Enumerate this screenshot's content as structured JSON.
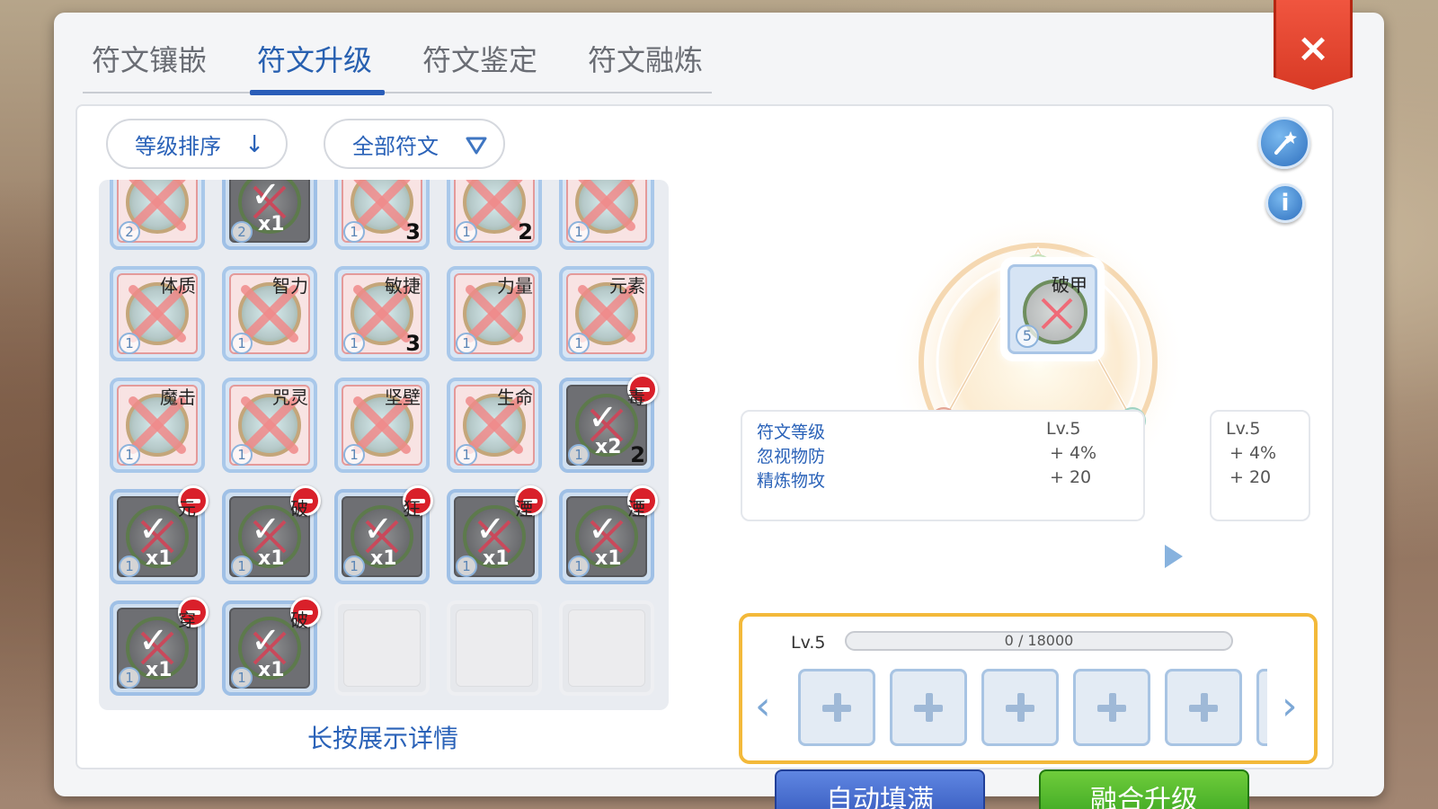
{
  "tabs": [
    {
      "label": "符文镶嵌",
      "active": false
    },
    {
      "label": "符文升级",
      "active": true
    },
    {
      "label": "符文鉴定",
      "active": false
    },
    {
      "label": "符文融炼",
      "active": false
    }
  ],
  "close_label": "×",
  "sort": {
    "label": "等级排序",
    "icon": "arrow-down-icon"
  },
  "filter": {
    "label": "全部符文",
    "icon": "triangle-down-icon"
  },
  "grid": {
    "hint": "长按展示详情",
    "row0": [
      {
        "name": "",
        "level": "2",
        "count": "",
        "mult": "",
        "state": "pink"
      },
      {
        "name": "",
        "level": "2",
        "count": "",
        "mult": "x1",
        "state": "dark"
      },
      {
        "name": "",
        "level": "1",
        "count": "3",
        "mult": "",
        "state": "pink"
      },
      {
        "name": "",
        "level": "1",
        "count": "2",
        "mult": "",
        "state": "pink"
      },
      {
        "name": "",
        "level": "1",
        "count": "",
        "mult": "",
        "state": "pink"
      }
    ],
    "row1": [
      {
        "name": "体质",
        "level": "1",
        "count": "",
        "mult": "",
        "state": "pink"
      },
      {
        "name": "智力",
        "level": "1",
        "count": "",
        "mult": "",
        "state": "pink"
      },
      {
        "name": "敏捷",
        "level": "1",
        "count": "3",
        "mult": "",
        "state": "pink"
      },
      {
        "name": "力量",
        "level": "1",
        "count": "",
        "mult": "",
        "state": "pink"
      },
      {
        "name": "元素",
        "level": "1",
        "count": "",
        "mult": "",
        "state": "pink"
      }
    ],
    "row2": [
      {
        "name": "魔击",
        "level": "1",
        "count": "",
        "mult": "",
        "state": "pink"
      },
      {
        "name": "咒灵",
        "level": "1",
        "count": "",
        "mult": "",
        "state": "pink"
      },
      {
        "name": "坚壁",
        "level": "1",
        "count": "",
        "mult": "",
        "state": "pink"
      },
      {
        "name": "生命",
        "level": "1",
        "count": "",
        "mult": "",
        "state": "pink"
      },
      {
        "name": "毒",
        "level": "1",
        "count": "2",
        "mult": "x2",
        "state": "dark"
      }
    ],
    "row3": [
      {
        "name": "元",
        "level": "1",
        "count": "",
        "mult": "x1",
        "state": "dark"
      },
      {
        "name": "破",
        "level": "1",
        "count": "",
        "mult": "x1",
        "state": "dark"
      },
      {
        "name": "狂",
        "level": "1",
        "count": "",
        "mult": "x1",
        "state": "dark"
      },
      {
        "name": "湮",
        "level": "1",
        "count": "",
        "mult": "x1",
        "state": "dark"
      },
      {
        "name": "湮",
        "level": "1",
        "count": "",
        "mult": "x1",
        "state": "dark"
      }
    ],
    "row4": [
      {
        "name": "穿",
        "level": "1",
        "count": "",
        "mult": "x1",
        "state": "dark"
      },
      {
        "name": "破",
        "level": "1",
        "count": "",
        "mult": "x1",
        "state": "dark"
      }
    ]
  },
  "selected": {
    "name": "破甲",
    "level": "5"
  },
  "stats": {
    "current": {
      "rows": [
        {
          "label": "符文等级",
          "value": "Lv.5"
        },
        {
          "label": "忽视物防",
          "value": "+ 4%"
        },
        {
          "label": "精炼物攻",
          "value": "+ 20"
        }
      ]
    },
    "next": [
      "Lv.5",
      "+ 4%",
      "+ 20"
    ]
  },
  "upgrade": {
    "level": "Lv.5",
    "exp_text": "0 / 18000",
    "exp_fraction": 0
  },
  "buttons": {
    "auto_fill": "自动填满",
    "merge_upgrade": "融合升级"
  },
  "colors": {
    "accent_blue": "#2a62b8",
    "close_red": "#e0422e",
    "highlight_orange": "#f3b93a",
    "btn_green": "#3aa722"
  }
}
